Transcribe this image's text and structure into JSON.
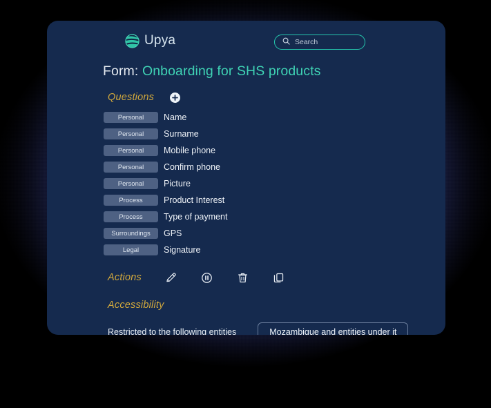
{
  "brand": {
    "name": "Upya",
    "logo_icon": "sphere-logo-icon",
    "logo_color": "#2fc4a6"
  },
  "search": {
    "placeholder": "Search",
    "icon": "search-icon",
    "border_color": "#25c9ae"
  },
  "page": {
    "title_prefix": "Form:",
    "title_value": "Onboarding for SHS products",
    "accent_color": "#3fd2b4"
  },
  "sections": {
    "questions_label": "Questions",
    "actions_label": "Actions",
    "accessibility_label": "Accessibility",
    "section_color": "#d2a93c"
  },
  "questions": {
    "add_icon": "plus-circle-icon",
    "items": [
      {
        "tag": "Personal",
        "label": "Name"
      },
      {
        "tag": "Personal",
        "label": "Surname"
      },
      {
        "tag": "Personal",
        "label": "Mobile phone"
      },
      {
        "tag": "Personal",
        "label": "Confirm phone"
      },
      {
        "tag": "Personal",
        "label": "Picture"
      },
      {
        "tag": "Process",
        "label": "Product Interest"
      },
      {
        "tag": "Process",
        "label": "Type of payment"
      },
      {
        "tag": "Surroundings",
        "label": "GPS"
      },
      {
        "tag": "Legal",
        "label": "Signature"
      }
    ],
    "tag_color": "#4e6183"
  },
  "actions": {
    "items": [
      {
        "icon": "pencil-edit-icon",
        "name": "edit-action"
      },
      {
        "icon": "pause-circle-icon",
        "name": "pause-action"
      },
      {
        "icon": "trash-delete-icon",
        "name": "delete-action"
      },
      {
        "icon": "copy-duplicate-icon",
        "name": "duplicate-action"
      }
    ]
  },
  "accessibility": {
    "restriction_label": "Restricted to the following entities",
    "entity_value": "Mozambique and entities under it"
  },
  "theme": {
    "card_background": "#152a4e",
    "page_background": "#000000",
    "glow_color": "#3a3f9c"
  }
}
